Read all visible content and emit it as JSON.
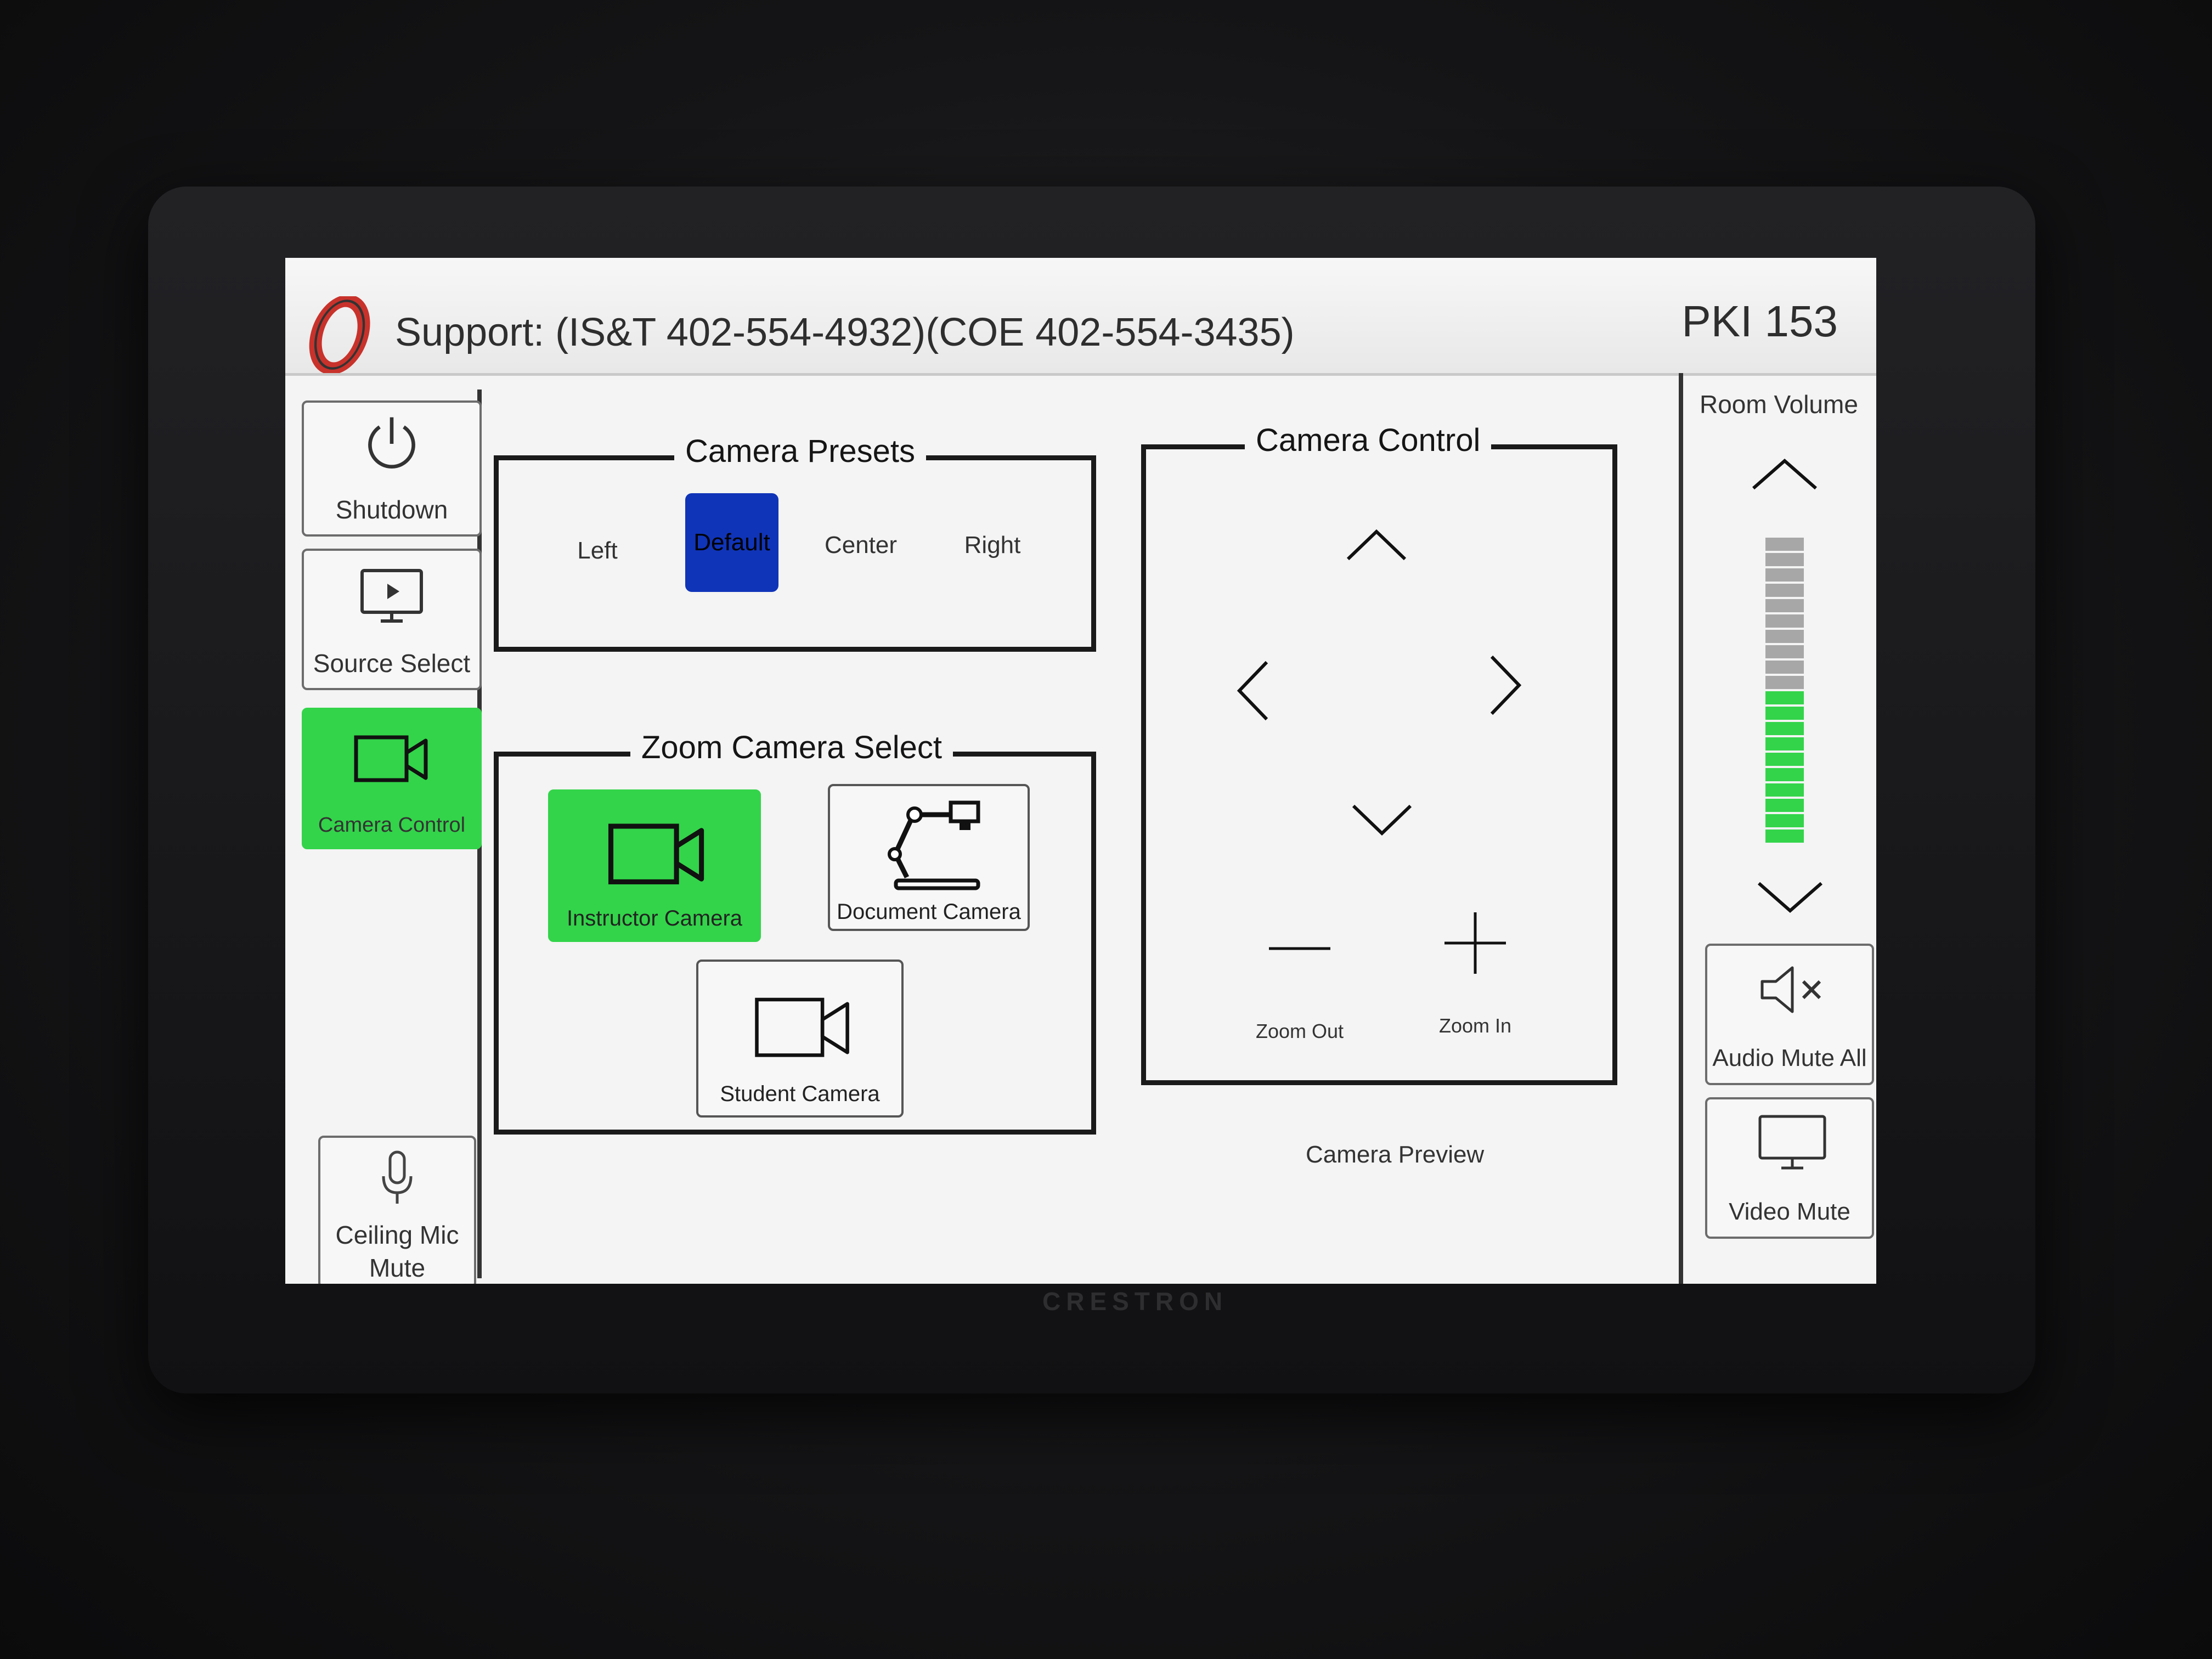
{
  "header": {
    "support": "Support: (IS&T 402-554-4932)(COE 402-554-3435)",
    "room": "PKI 153"
  },
  "sidebar": {
    "items": [
      {
        "label": "Shutdown",
        "icon": "power-icon",
        "active": false
      },
      {
        "label": "Source Select",
        "icon": "monitor-play-icon",
        "active": false
      },
      {
        "label": "Camera Control",
        "icon": "video-camera-icon",
        "active": true
      }
    ],
    "ceiling_mic": {
      "line1": "Ceiling Mic",
      "line2": "Mute",
      "icon": "microphone-icon"
    }
  },
  "camera_presets": {
    "title": "Camera Presets",
    "items": [
      "Left",
      "Default",
      "Center",
      "Right"
    ],
    "selected": "Default"
  },
  "zoom_camera_select": {
    "title": "Zoom Camera Select",
    "cameras": [
      {
        "label": "Instructor Camera",
        "icon": "video-camera-icon",
        "active": true
      },
      {
        "label": "Document Camera",
        "icon": "document-camera-icon",
        "active": false
      },
      {
        "label": "Student Camera",
        "icon": "video-camera-icon",
        "active": false
      }
    ]
  },
  "camera_control": {
    "title": "Camera Control",
    "zoom_out": "Zoom Out",
    "zoom_in": "Zoom In"
  },
  "camera_preview": "Camera Preview",
  "volume": {
    "title": "Room Volume",
    "level": 0.5,
    "segments": 20
  },
  "right_buttons": {
    "audio_mute_all": "Audio Mute All",
    "video_mute": "Video Mute"
  },
  "brand": "CRESTRON",
  "colors": {
    "active": "#33d44a",
    "preset_selected": "#1034b8",
    "logo_red": "#c8322b"
  }
}
